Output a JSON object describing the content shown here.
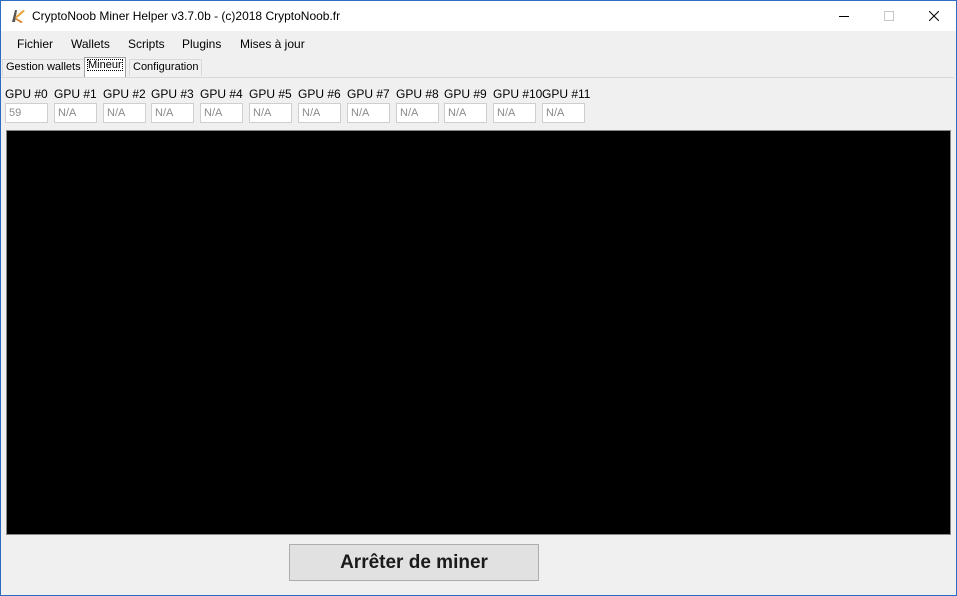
{
  "window": {
    "title": "CryptoNoob Miner Helper v3.7.0b - (c)2018 CryptoNoob.fr"
  },
  "menu": {
    "items": [
      "Fichier",
      "Wallets",
      "Scripts",
      "Plugins",
      "Mises à jour"
    ]
  },
  "tabs": [
    {
      "label": "Gestion wallets",
      "active": false
    },
    {
      "label": "Mineur",
      "active": true
    },
    {
      "label": "Configuration",
      "active": false
    }
  ],
  "gpus": [
    {
      "label": "GPU #0",
      "value": "59"
    },
    {
      "label": "GPU #1",
      "value": "N/A"
    },
    {
      "label": "GPU #2",
      "value": "N/A"
    },
    {
      "label": "GPU #3",
      "value": "N/A"
    },
    {
      "label": "GPU #4",
      "value": "N/A"
    },
    {
      "label": "GPU #5",
      "value": "N/A"
    },
    {
      "label": "GPU #6",
      "value": "N/A"
    },
    {
      "label": "GPU #7",
      "value": "N/A"
    },
    {
      "label": "GPU #8",
      "value": "N/A"
    },
    {
      "label": "GPU #9",
      "value": "N/A"
    },
    {
      "label": "GPU #10",
      "value": "N/A"
    },
    {
      "label": "GPU #11",
      "value": "N/A"
    }
  ],
  "actions": {
    "stop_label": "Arrêter de miner"
  },
  "icons": {
    "app": "cryptonoob-app-icon",
    "minimize": "minimize-icon",
    "maximize": "maximize-icon",
    "close": "close-icon"
  }
}
